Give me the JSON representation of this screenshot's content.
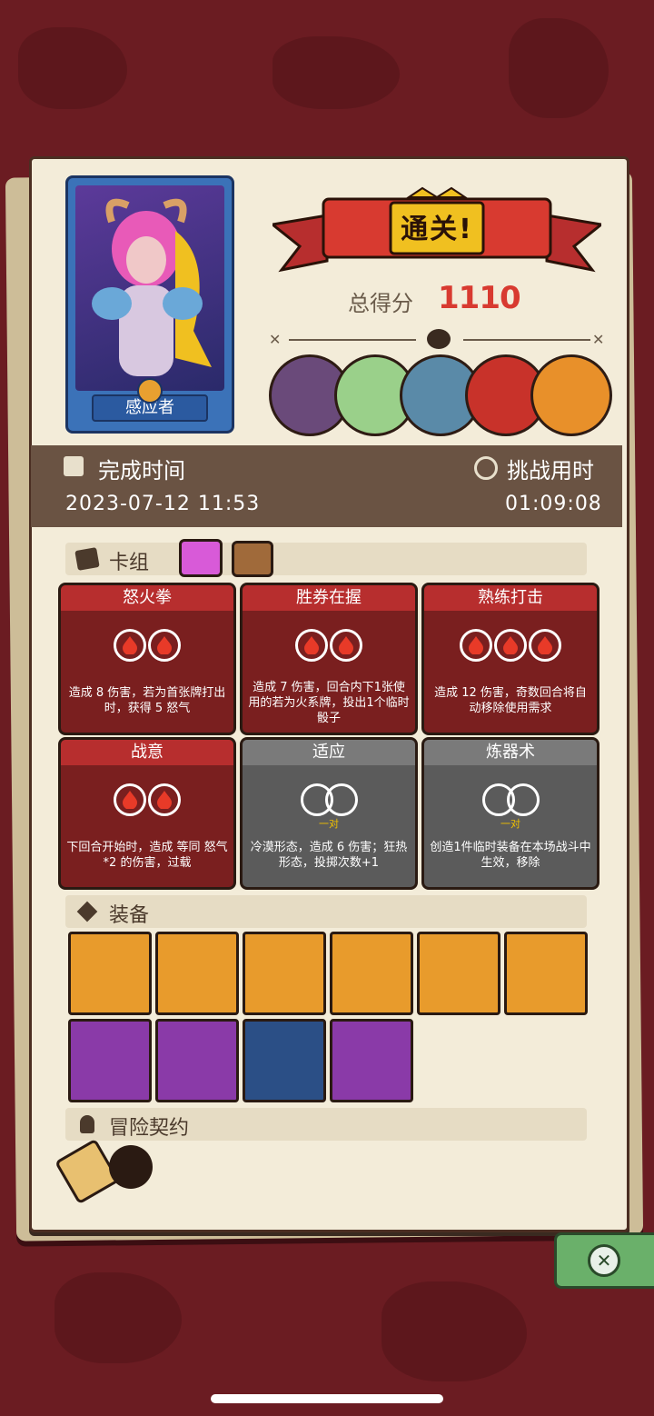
{
  "hero": {
    "name": "感应者"
  },
  "result": {
    "banner": "通关!",
    "score_label": "总得分",
    "score": "1110"
  },
  "times": {
    "finish_label": "完成时间",
    "finish_value": "2023-07-12 11:53",
    "challenge_label": "挑战用时",
    "challenge_value": "01:09:08"
  },
  "sections": {
    "deck": "卡组",
    "equipment": "装备",
    "contract": "冒险契约"
  },
  "cards": [
    {
      "name": "怒火拳",
      "type": "red",
      "orbs": 2,
      "desc": "造成 8 伤害，若为首张牌打出时，获得 5 怒气"
    },
    {
      "name": "胜券在握",
      "type": "red",
      "orbs": 2,
      "desc": "造成 7 伤害，回合内下1张使用的若为火系牌，投出1个临时骰子"
    },
    {
      "name": "熟练打击",
      "type": "red",
      "orbs": 3,
      "desc": "造成 12 伤害，奇数回合将自动移除使用需求"
    },
    {
      "name": "战意",
      "type": "red",
      "orbs": 2,
      "desc": "下回合开始时，造成 等同 怒气*2 的伤害，过载"
    },
    {
      "name": "适应",
      "type": "grey",
      "pair": "一对",
      "desc": "冷漠形态，造成 6 伤害；狂热形态，投掷次数+1"
    },
    {
      "name": "炼器术",
      "type": "grey",
      "pair": "一对",
      "desc": "创造1件临时装备在本场战斗中生效，移除"
    }
  ],
  "colors": {
    "accent_red": "#d83a30",
    "keyword_yellow": "#f0c000",
    "paper": "#f3ecd9",
    "bar": "#6a5343"
  },
  "icons": {
    "finish": "calendar-icon",
    "challenge": "stopwatch-icon",
    "deck": "cards-icon",
    "equipment": "cube-icon",
    "contract": "person-icon",
    "close": "close-icon"
  }
}
